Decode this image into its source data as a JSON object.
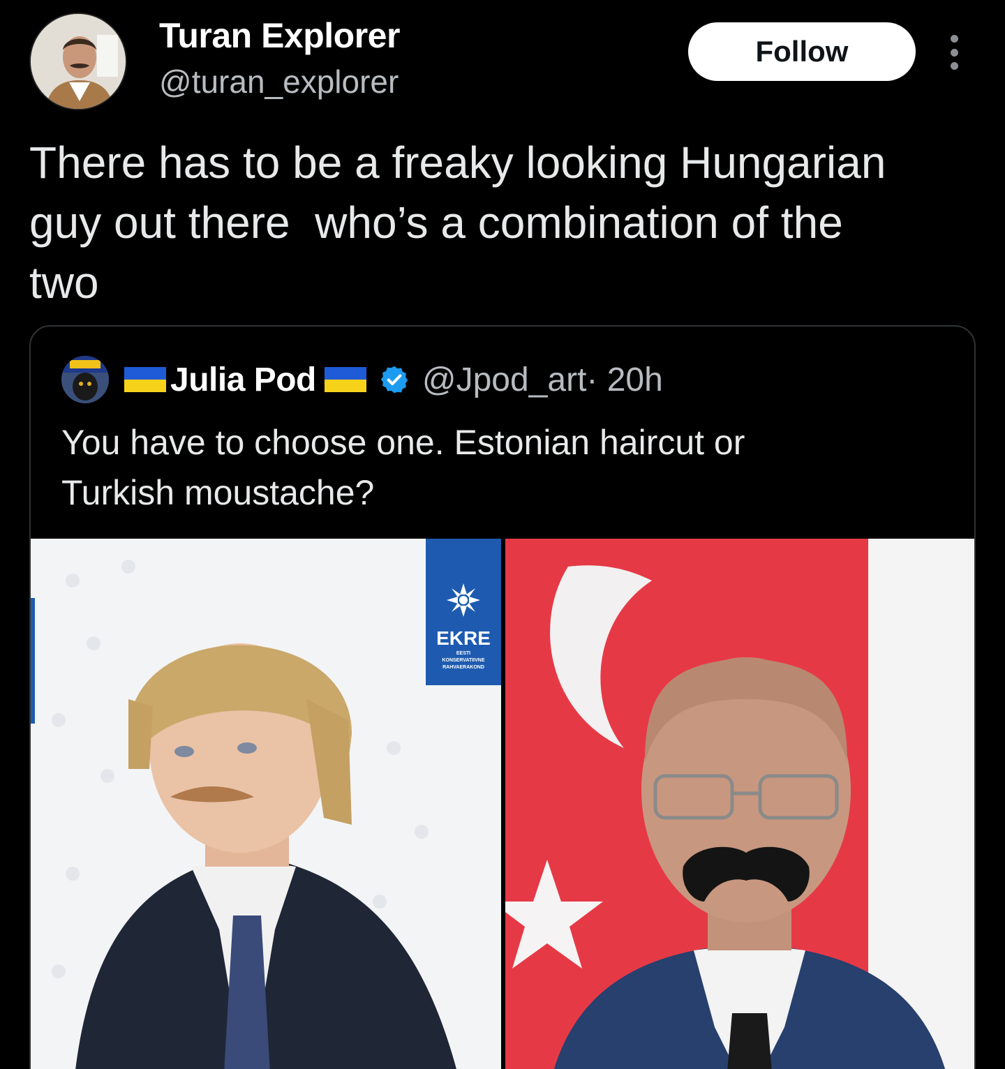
{
  "author": {
    "name": "Turan Explorer",
    "handle": "@turan_explorer",
    "avatar_icon": "profile-photo"
  },
  "follow_label": "Follow",
  "more_icon": "more-vertical-icon",
  "tweet": {
    "text": "There has to be a freaky looking Hungarian\nguy out there  who’s a combination of the\ntwo"
  },
  "quote": {
    "name": "Julia Pod",
    "handle": "@Jpod_art",
    "time": " · 20h",
    "text": "You have to choose one. Estonian haircut or\nTurkish moustache?",
    "verified_color": "#1d9bf0",
    "flag_colors": [
      "#1f5bd6",
      "#f7d21a"
    ]
  },
  "images": {
    "left": {
      "logo_title": "EKRE",
      "logo_line1": "EESTI",
      "logo_line2": "KONSERVATIIVNE",
      "logo_line3": "RAHVAERAKOND",
      "logo_color": "#1e5bb0"
    },
    "right": {
      "flag_color": "#e63946"
    }
  }
}
